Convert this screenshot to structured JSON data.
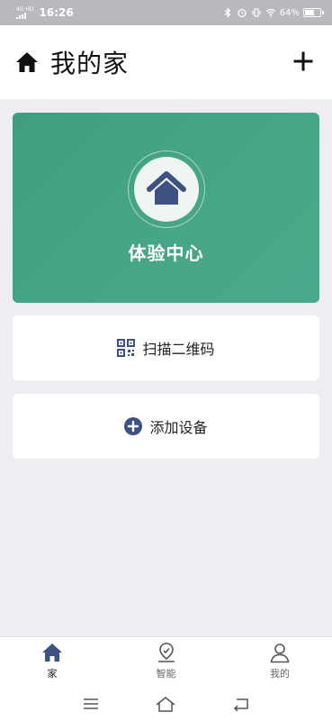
{
  "status_bar": {
    "network": "4G HD",
    "time": "16:26",
    "battery": "64%",
    "battery_level": 0.64
  },
  "header": {
    "title": "我的家",
    "home_icon": "home-icon",
    "add_icon": "plus-icon"
  },
  "hero": {
    "label": "体验中心",
    "icon": "house-icon"
  },
  "actions": {
    "scan_label": "扫描二维码",
    "add_label": "添加设备"
  },
  "bottom_nav": [
    {
      "label": "家",
      "icon": "home-icon",
      "active": true
    },
    {
      "label": "智能",
      "icon": "smart-location-icon",
      "active": false
    },
    {
      "label": "我的",
      "icon": "user-icon",
      "active": false
    }
  ],
  "colors": {
    "accent": "#3e5183",
    "hero_green": "#43a383"
  }
}
